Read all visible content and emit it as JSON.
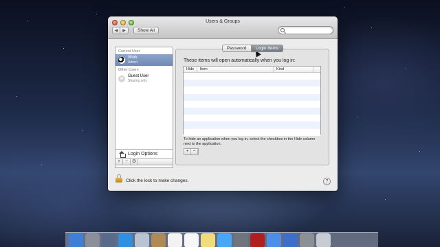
{
  "window": {
    "title": "Users & Groups",
    "nav_back": "◀",
    "nav_forward": "▶",
    "show_all": "Show All",
    "search_placeholder": ""
  },
  "sidebar": {
    "current_user_header": "Current User",
    "current_user": {
      "name": "Work",
      "role": "Admin"
    },
    "other_users_header": "Other Users",
    "other_users": [
      {
        "name": "Guest User",
        "role": "Sharing only"
      }
    ],
    "login_options_label": "Login Options",
    "add_label": "+",
    "remove_label": "−",
    "settings_label": "⚙"
  },
  "tabs": [
    {
      "label": "Password",
      "active": false
    },
    {
      "label": "Login Items",
      "active": true
    }
  ],
  "login_items": {
    "message": "These items will open automatically when you log in:",
    "columns": [
      "Hide",
      "Item",
      "Kind"
    ],
    "rows": [],
    "hint": "To hide an application when you log in, select the checkbox in the Hide column next to the application.",
    "add_label": "+",
    "remove_label": "−"
  },
  "footer": {
    "lock_text": "Click the lock to make changes.",
    "help_label": "?"
  },
  "dock": {
    "items": [
      {
        "icon": "finder-icon",
        "color": "#3f7fd6"
      },
      {
        "icon": "launchpad-icon",
        "color": "#8a8f9a"
      },
      {
        "icon": "mission-control-icon",
        "color": "#5a6b8a"
      },
      {
        "icon": "safari-icon",
        "color": "#2f8fe0"
      },
      {
        "icon": "mail-icon",
        "color": "#b9c3d2"
      },
      {
        "icon": "contacts-icon",
        "color": "#b08a55"
      },
      {
        "icon": "calendar-icon",
        "color": "#f2f2f2"
      },
      {
        "icon": "reminders-icon",
        "color": "#f7f7f7"
      },
      {
        "icon": "notes-icon",
        "color": "#f1dc7a"
      },
      {
        "icon": "messages-icon",
        "color": "#47a7f5"
      },
      {
        "icon": "facetime-icon",
        "color": "#6f747d"
      },
      {
        "icon": "photo-booth-icon",
        "color": "#b01e1e"
      },
      {
        "icon": "itunes-icon",
        "color": "#4d8fe8"
      },
      {
        "icon": "app-store-icon",
        "color": "#3d6ec9"
      },
      {
        "icon": "system-preferences-icon",
        "color": "#8b8f96"
      },
      {
        "icon": "trash-icon",
        "color": "#c7ccd3"
      }
    ]
  }
}
